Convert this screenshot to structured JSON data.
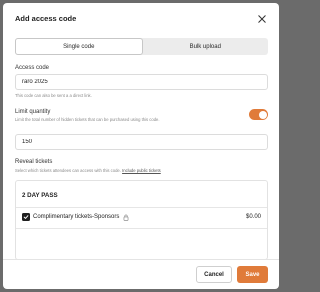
{
  "modal": {
    "title": "Add access code"
  },
  "tabs": [
    {
      "label": "Single code",
      "active": true
    },
    {
      "label": "Bulk upload",
      "active": false
    }
  ],
  "access_code": {
    "label": "Access code",
    "value": "raro 2025",
    "hint": "This code can also be sent a a direct link."
  },
  "limit_quantity": {
    "label": "Limit quantity",
    "hint": "Limit the total number of hidden tickets that can be purchased using this code.",
    "enabled": true,
    "value": "150"
  },
  "reveal_tickets": {
    "label": "Reveal tickets",
    "hint": "Select which tickets attendees can access with this code.",
    "link": "Include public tickets"
  },
  "ticket_group": {
    "name": "2 DAY PASS",
    "tickets": [
      {
        "name": "Complimentary tickets-Sponsors",
        "price": "$0.00",
        "checked": true,
        "icon": "lock-icon"
      }
    ]
  },
  "footer": {
    "cancel_label": "Cancel",
    "save_label": "Save"
  },
  "colors": {
    "accent": "#e07b3a",
    "overlay": "#6b6b6b"
  }
}
